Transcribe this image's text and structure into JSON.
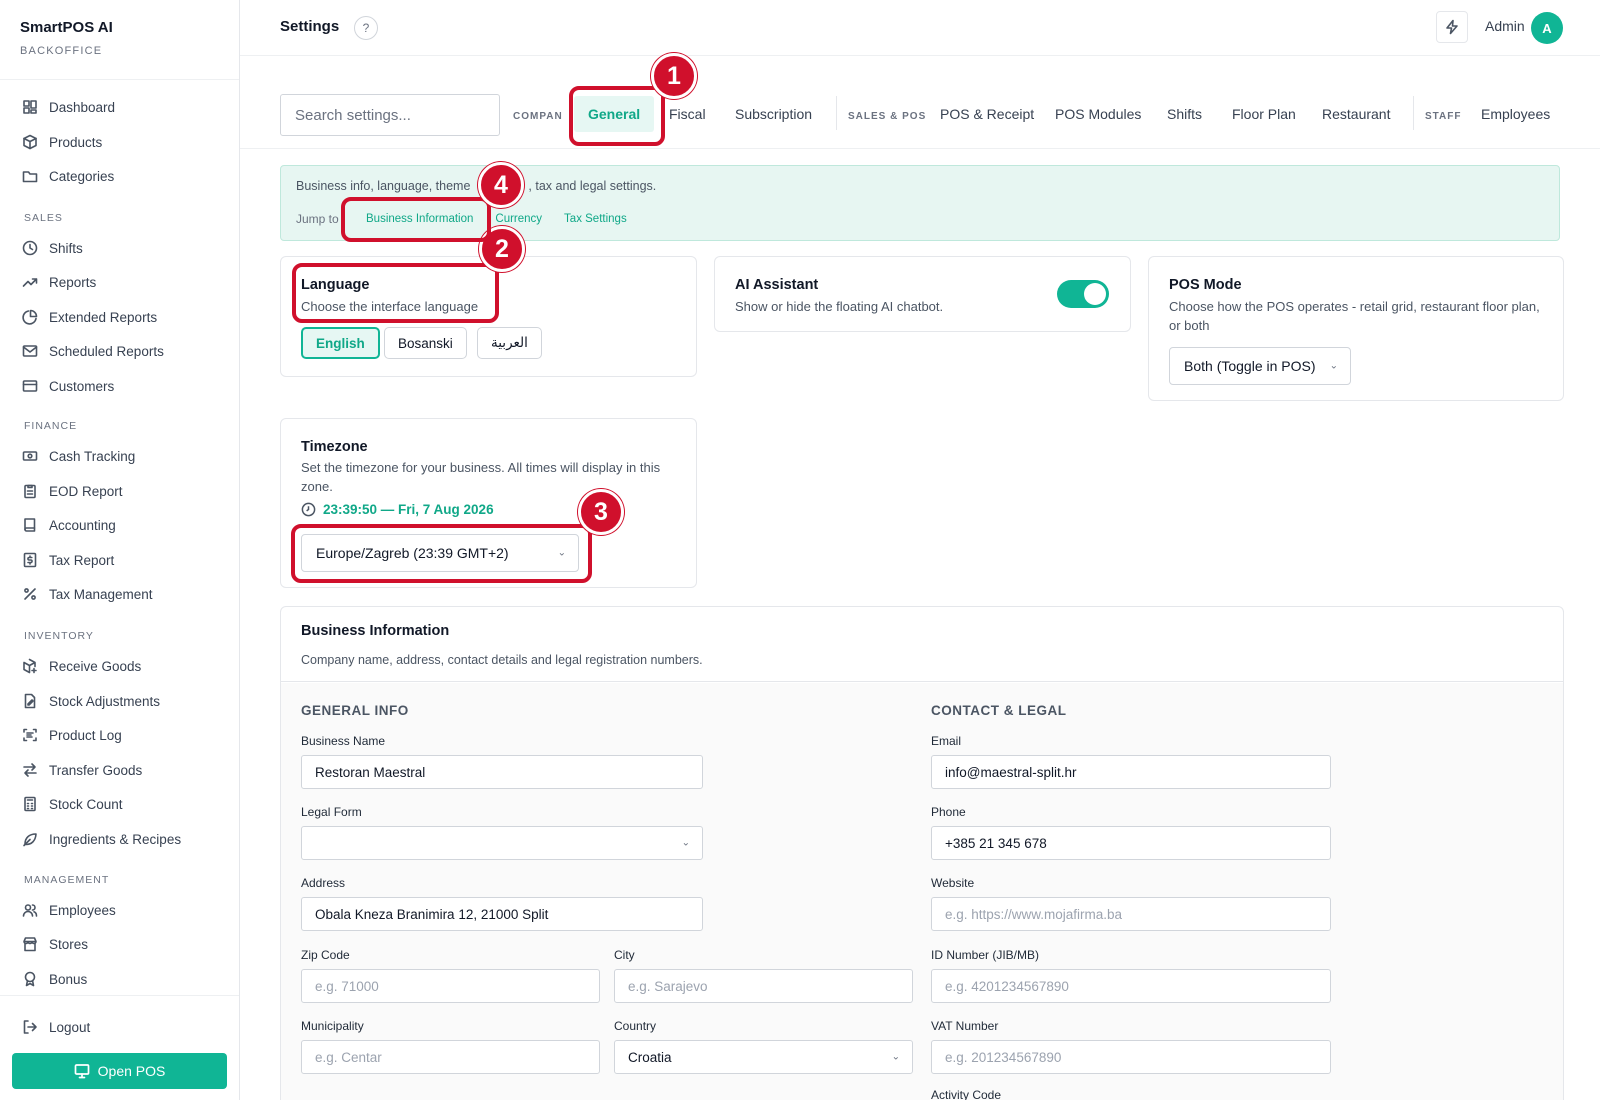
{
  "brand": {
    "title": "SmartPOS AI",
    "subtitle": "BACKOFFICE"
  },
  "nav": {
    "dashboard": "Dashboard",
    "products": "Products",
    "categories": "Categories",
    "sales_label": "SALES",
    "shifts": "Shifts",
    "reports": "Reports",
    "extended_reports": "Extended Reports",
    "scheduled_reports": "Scheduled Reports",
    "customers": "Customers",
    "finance_label": "FINANCE",
    "cash_tracking": "Cash Tracking",
    "eod_report": "EOD Report",
    "accounting": "Accounting",
    "tax_report": "Tax Report",
    "tax_management": "Tax Management",
    "inventory_label": "INVENTORY",
    "receive_goods": "Receive Goods",
    "stock_adjustments": "Stock Adjustments",
    "product_log": "Product Log",
    "transfer_goods": "Transfer Goods",
    "stock_count": "Stock Count",
    "ingredients_recipes": "Ingredients & Recipes",
    "management_label": "MANAGEMENT",
    "employees": "Employees",
    "stores": "Stores",
    "bonus": "Bonus",
    "logout": "Logout",
    "open_pos": "Open POS"
  },
  "header": {
    "title": "Settings",
    "help": "?",
    "user": "Admin",
    "avatar_initial": "A"
  },
  "tabs": {
    "search_placeholder": "Search settings...",
    "company_label": "COMPANY",
    "general": "General",
    "fiscal": "Fiscal",
    "subscription": "Subscription",
    "sales_pos_label": "SALES & POS",
    "pos_receipt": "POS & Receipt",
    "pos_modules": "POS Modules",
    "shifts": "Shifts",
    "floor_plan": "Floor Plan",
    "restaurant": "Restaurant",
    "staff_label": "STAFF",
    "employees": "Employees"
  },
  "intro": {
    "description_a": "Business info, language, theme",
    "description_b": ", tax and legal settings.",
    "jump_to": "Jump to",
    "links": [
      "Business Information",
      "Currency",
      "Tax Settings"
    ]
  },
  "language": {
    "title": "Language",
    "description": "Choose the interface language",
    "options": [
      "English",
      "Bosanski",
      "العربية"
    ],
    "selected": "English"
  },
  "ai_assistant": {
    "title": "AI Assistant",
    "description": "Show or hide the floating AI chatbot.",
    "enabled": true
  },
  "pos_mode": {
    "title": "POS Mode",
    "description": "Choose how the POS operates - retail grid, restaurant floor plan, or both",
    "value": "Both (Toggle in POS)"
  },
  "timezone": {
    "title": "Timezone",
    "description": "Set the timezone for your business. All times will display in this zone.",
    "current_time": "23:39:50 — Fri, 7 Aug 2026",
    "value": "Europe/Zagreb (23:39 GMT+2)"
  },
  "business": {
    "title": "Business Information",
    "description": "Company name, address, contact details and legal registration numbers.",
    "general_title": "GENERAL INFO",
    "contact_title": "CONTACT & LEGAL",
    "business_name_label": "Business Name",
    "business_name": "Restoran Maestral",
    "legal_form_label": "Legal Form",
    "legal_form": "",
    "address_label": "Address",
    "address": "Obala Kneza Branimira 12, 21000 Split",
    "zip_label": "Zip Code",
    "zip_placeholder": "e.g. 71000",
    "city_label": "City",
    "city_placeholder": "e.g. Sarajevo",
    "municipality_label": "Municipality",
    "municipality_placeholder": "e.g. Centar",
    "country_label": "Country",
    "country": "Croatia",
    "email_label": "Email",
    "email": "info@maestral-split.hr",
    "phone_label": "Phone",
    "phone": "+385 21 345 678",
    "website_label": "Website",
    "website_placeholder": "e.g. https://www.mojafirma.ba",
    "id_label": "ID Number (JIB/MB)",
    "id_placeholder": "e.g. 4201234567890",
    "vat_label": "VAT Number",
    "vat_placeholder": "e.g. 201234567890",
    "activity_label": "Activity Code"
  },
  "annotations": [
    "1",
    "2",
    "3",
    "4"
  ],
  "colors": {
    "accent": "#10b595",
    "annotation": "#d0102c"
  }
}
